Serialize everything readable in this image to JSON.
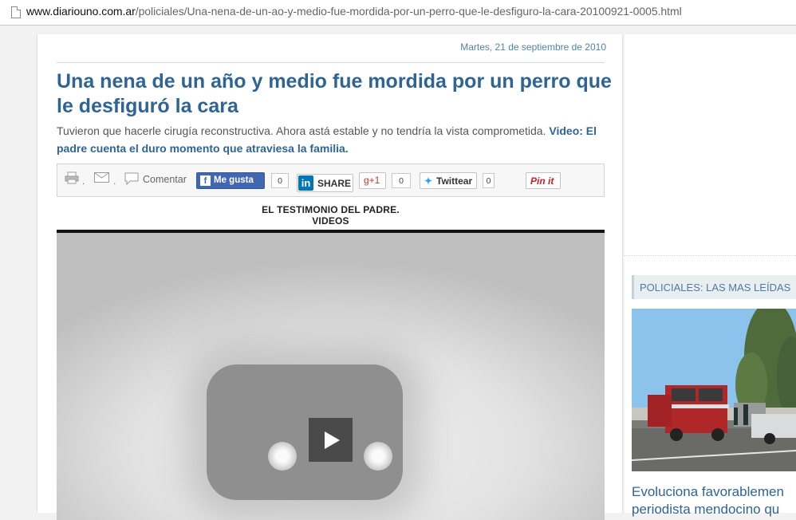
{
  "browser": {
    "url_domain": "www.diariouno.com.ar",
    "url_path": "/policiales/Una-nena-de-un-ao-y-medio-fue-mordida-por-un-perro-que-le-desfiguro-la-cara-20100921-0005.html"
  },
  "article": {
    "date": "Martes, 21 de septiembre de 2010",
    "headline": "Una nena de un año y medio fue mordida por un perro que le desfiguró la cara",
    "summary": "Tuvieron que hacerle cirugía reconstructiva. Ahora astá estable y no tendría la vista comprometida.",
    "summary_video": "Video: El padre cuenta el duro momento que atraviesa la familia."
  },
  "sharebar": {
    "separator": ".",
    "comment_label": "Comentar",
    "facebook_label": "Me gusta",
    "facebook_count": "0",
    "linkedin_label": "SHARE",
    "gplus_label": "g+1",
    "gplus_count": "0",
    "twitter_label": "Twittear",
    "twitter_count": "0",
    "pinterest_label": "Pin it"
  },
  "video": {
    "caption_line1": "EL TESTIMONIO DEL PADRE.",
    "caption_line2": "VIDEOS"
  },
  "sidebar": {
    "header": "POLICIALES: LAS MAS LEÍDAS",
    "story_title_line1": "Evoluciona favorablemen",
    "story_title_line2": "periodista mendocino qu"
  },
  "colors": {
    "link_blue": "#2f6494",
    "facebook_blue": "#4267b2",
    "linkedin_blue": "#0077b5",
    "pinterest_red": "#cb2027"
  }
}
